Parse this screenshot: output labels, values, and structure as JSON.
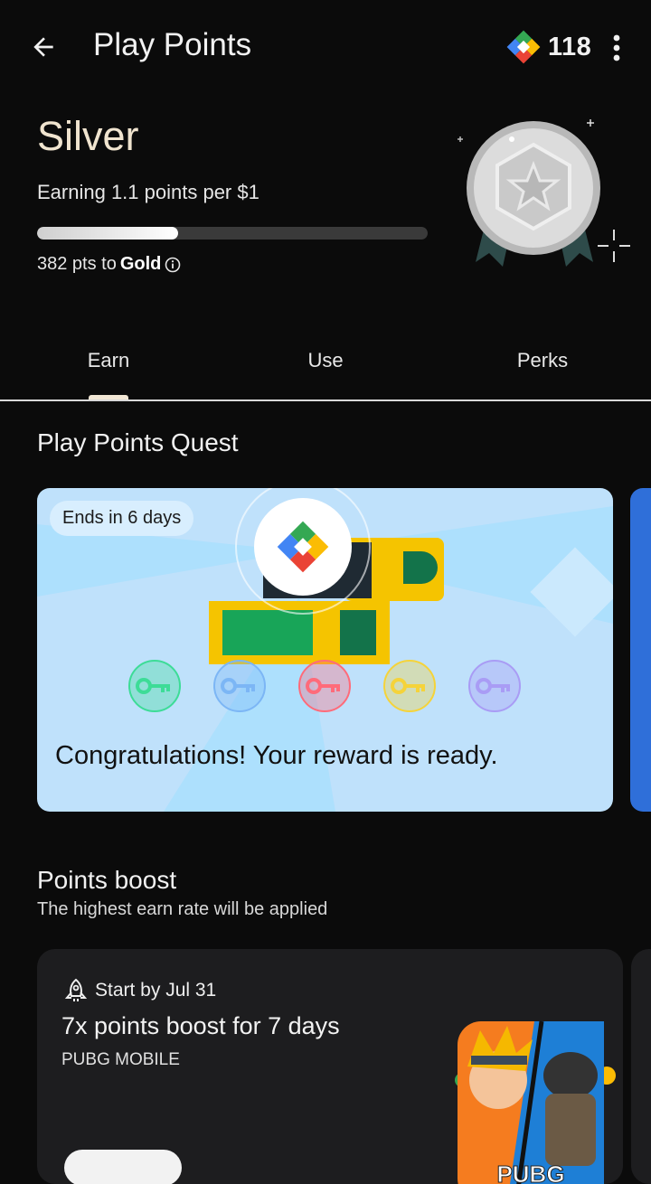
{
  "header": {
    "title": "Play Points",
    "points_balance": "118",
    "back_icon": "arrow-left-icon",
    "more_icon": "more-vert-icon"
  },
  "tier": {
    "name": "Silver",
    "earning_text": "Earning 1.1 points per $1",
    "progress_fraction": 0.36,
    "to_next_prefix": "382 pts to",
    "next_tier": "Gold",
    "medal_icon": "silver-medal-icon"
  },
  "tabs": [
    {
      "label": "Earn",
      "selected": true
    },
    {
      "label": "Use",
      "selected": false
    },
    {
      "label": "Perks",
      "selected": false
    }
  ],
  "quest": {
    "section_title": "Play Points Quest",
    "ends_label": "Ends in 6 days",
    "message": "Congratulations! Your reward is ready.",
    "keys": [
      {
        "color": "#3ddc97"
      },
      {
        "color": "#7cb6f5"
      },
      {
        "color": "#ff6b7a"
      },
      {
        "color": "#f5d33a"
      },
      {
        "color": "#a99cf5"
      }
    ]
  },
  "boost": {
    "section_title": "Points boost",
    "subtitle": "The highest earn rate will be applied",
    "start_label": "Start by Jul 31",
    "headline": "7x points boost for 7 days",
    "game": "PUBG MOBILE",
    "game_art_text": "PUBG"
  },
  "colors": {
    "background": "#0b0b0b",
    "tier_text": "#f0e4cf",
    "quest_card": "#bfe1fb"
  }
}
